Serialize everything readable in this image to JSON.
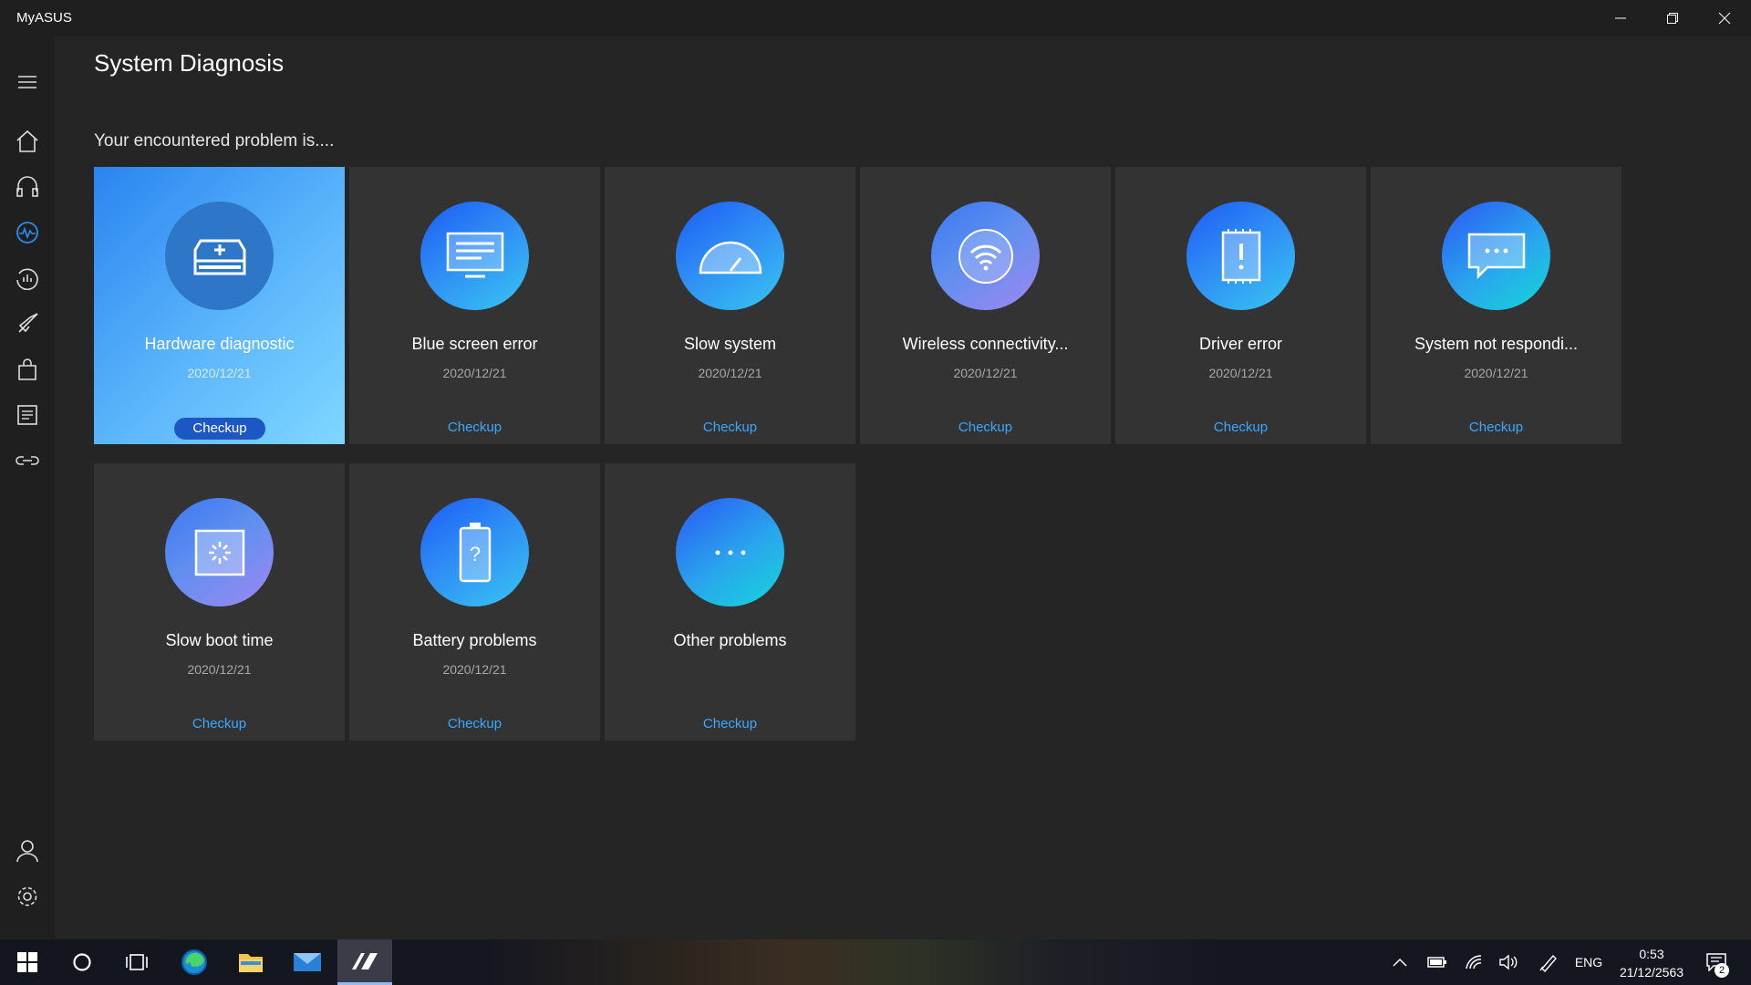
{
  "window": {
    "title": "MyASUS"
  },
  "page": {
    "title": "System Diagnosis",
    "subtitle": "Your encountered problem is...."
  },
  "cards": [
    {
      "name": "Hardware diagnostic",
      "date": "2020/12/21",
      "action": "Checkup",
      "icon": "hard-drive-icon",
      "selected": true
    },
    {
      "name": "Blue screen error",
      "date": "2020/12/21",
      "action": "Checkup",
      "icon": "monitor-icon"
    },
    {
      "name": "Slow system",
      "date": "2020/12/21",
      "action": "Checkup",
      "icon": "speedometer-icon"
    },
    {
      "name": "Wireless connectivity...",
      "date": "2020/12/21",
      "action": "Checkup",
      "icon": "wifi-icon"
    },
    {
      "name": "Driver error",
      "date": "2020/12/21",
      "action": "Checkup",
      "icon": "chip-alert-icon"
    },
    {
      "name": "System not respondi...",
      "date": "2020/12/21",
      "action": "Checkup",
      "icon": "chat-bubble-icon"
    },
    {
      "name": "Slow boot time",
      "date": "2020/12/21",
      "action": "Checkup",
      "icon": "loading-screen-icon"
    },
    {
      "name": "Battery problems",
      "date": "2020/12/21",
      "action": "Checkup",
      "icon": "battery-question-icon"
    },
    {
      "name": "Other problems",
      "date": "",
      "action": "Checkup",
      "icon": "more-dots-icon"
    }
  ],
  "sidebar": {
    "items": [
      "menu-icon",
      "home-icon",
      "headset-icon",
      "diagnosis-icon",
      "performance-icon",
      "rocket-icon",
      "store-icon",
      "news-icon",
      "link-icon"
    ],
    "bottom": [
      "account-icon",
      "settings-icon"
    ],
    "active": "diagnosis-icon"
  },
  "taskbar": {
    "language": "ENG",
    "time": "0:53",
    "date": "21/12/2563",
    "notifications": "2"
  },
  "colors": {
    "accent": "#3aa8ff",
    "selected_card_start": "#2a84f0",
    "selected_card_end": "#7fd7ff",
    "card_bg": "#333333",
    "background": "#252525"
  }
}
